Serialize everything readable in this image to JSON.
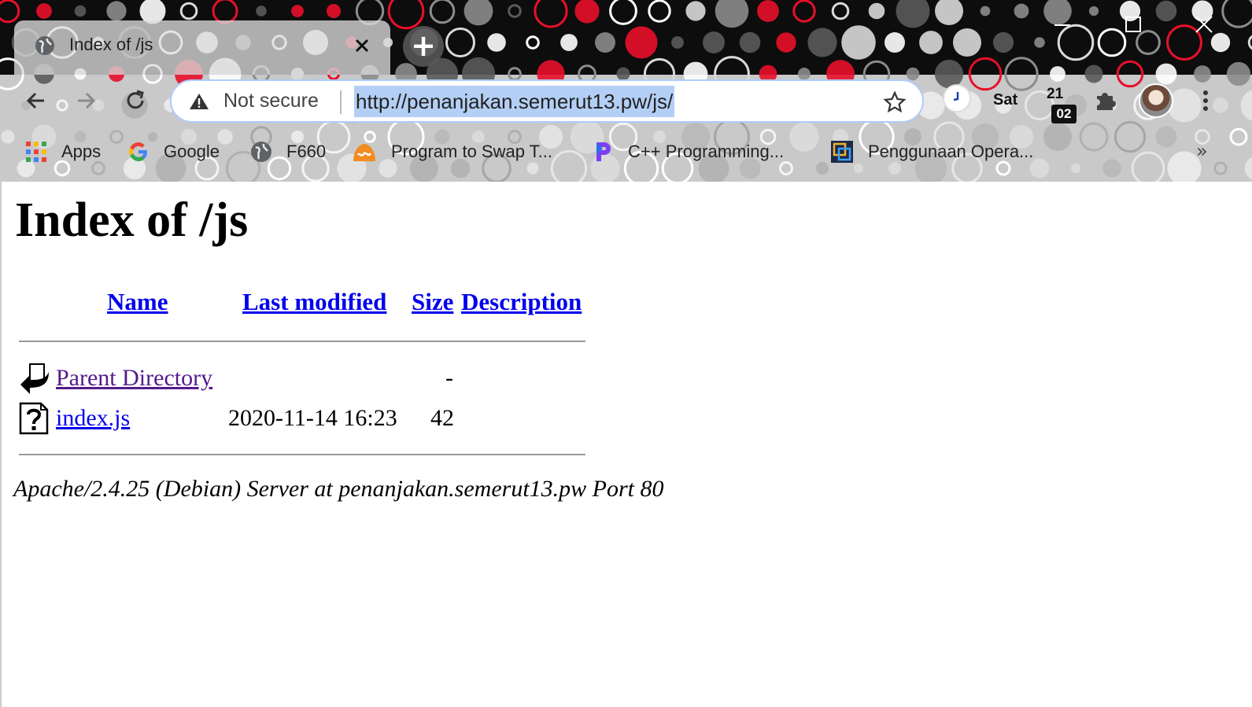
{
  "browser": {
    "tab": {
      "title": "Index of /js"
    },
    "new_tab_label": "+",
    "omnibox": {
      "security_label": "Not secure",
      "url": "http://penanjakan.semerut13.pw/js/"
    },
    "extensions": {
      "day": "Sat",
      "date_top": "21",
      "date_bottom": "02"
    },
    "bookmarks": [
      {
        "label": "Apps",
        "icon": "apps-grid-icon"
      },
      {
        "label": "Google",
        "icon": "google-icon"
      },
      {
        "label": "F660",
        "icon": "globe-icon"
      },
      {
        "label": "Program to Swap T...",
        "icon": "site-icon"
      },
      {
        "label": "C++ Programming...",
        "icon": "p-logo-icon"
      },
      {
        "label": "Penggunaan Opera...",
        "icon": "site-icon"
      }
    ],
    "bookmarks_more": "»"
  },
  "page": {
    "title": "Index of /js",
    "columns": {
      "name": "Name",
      "last_modified": "Last modified",
      "size": "Size",
      "description": "Description"
    },
    "rows": [
      {
        "name": "Parent Directory",
        "last_modified": "",
        "size": "-",
        "description": "",
        "icon": "back-arrow-icon"
      },
      {
        "name": "index.js",
        "last_modified": "2020-11-14 16:23",
        "size": "42",
        "description": "",
        "icon": "unknown-file-icon"
      }
    ],
    "address": "Apache/2.4.25 (Debian) Server at penanjakan.semerut13.pw Port 80"
  },
  "colors": {
    "link": "#0000ee",
    "visited_link": "#551a8b",
    "url_selection": "#b4cff5"
  }
}
